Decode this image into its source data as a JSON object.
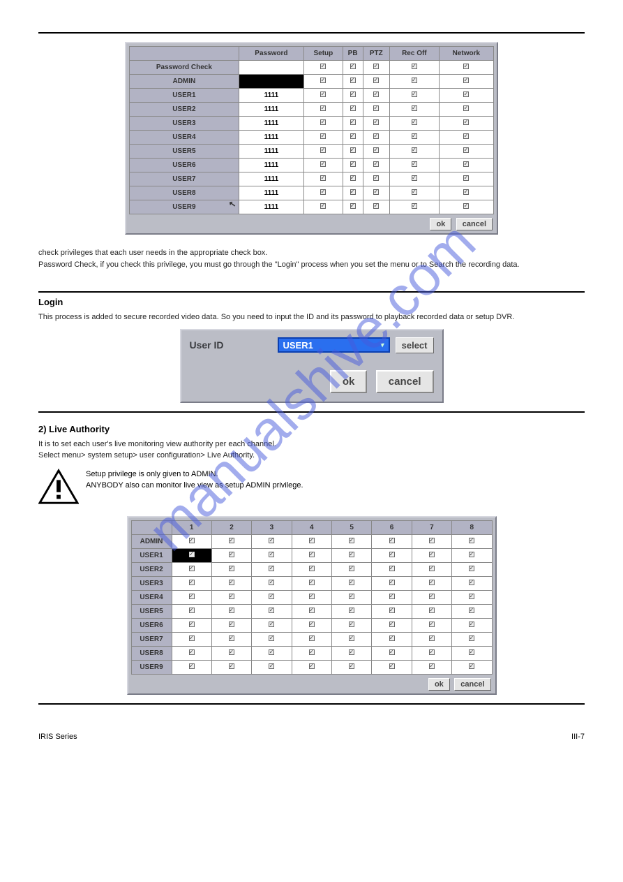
{
  "watermark_text": "manualshive.com",
  "section1": {
    "desc1": "check privileges that each user needs in the appropriate check box.",
    "desc2": "Password Check, if you check this privilege, you must go through the \"Login\" process when you set the menu or to Search the recording data.",
    "table": {
      "headers": [
        "Password",
        "Setup",
        "PB",
        "PTZ",
        "Rec Off",
        "Network"
      ],
      "row0_label": "Password Check",
      "rows": [
        {
          "label": "ADMIN",
          "pwd": ""
        },
        {
          "label": "USER1",
          "pwd": "1111"
        },
        {
          "label": "USER2",
          "pwd": "1111"
        },
        {
          "label": "USER3",
          "pwd": "1111"
        },
        {
          "label": "USER4",
          "pwd": "1111"
        },
        {
          "label": "USER5",
          "pwd": "1111"
        },
        {
          "label": "USER6",
          "pwd": "1111"
        },
        {
          "label": "USER7",
          "pwd": "1111"
        },
        {
          "label": "USER8",
          "pwd": "1111"
        },
        {
          "label": "USER9",
          "pwd": "1111"
        }
      ]
    },
    "btn_ok": "ok",
    "btn_cancel": "cancel"
  },
  "section2": {
    "heading": "Login",
    "desc": "This process is added to secure recorded video data. So you need to input the ID and its password to playback recorded data or setup DVR.",
    "label": "User  ID",
    "field_value": "USER1",
    "btn_select": "select",
    "btn_ok": "ok",
    "btn_cancel": "cancel"
  },
  "section3": {
    "heading": "2) Live Authority",
    "desc1": "It is to set each user's live monitoring view authority per each channel.",
    "desc2": "Select menu> system setup> user configuration> Live Authority.",
    "caution": "Setup privilege is only given to ADMIN.\nANYBODY also can monitor live view as setup ADMIN privilege.",
    "table": {
      "headers": [
        "1",
        "2",
        "3",
        "4",
        "5",
        "6",
        "7",
        "8"
      ],
      "rows": [
        {
          "label": "ADMIN"
        },
        {
          "label": "USER1"
        },
        {
          "label": "USER2"
        },
        {
          "label": "USER3"
        },
        {
          "label": "USER4"
        },
        {
          "label": "USER5"
        },
        {
          "label": "USER6"
        },
        {
          "label": "USER7"
        },
        {
          "label": "USER8"
        },
        {
          "label": "USER9"
        }
      ]
    },
    "btn_ok": "ok",
    "btn_cancel": "cancel"
  },
  "footer": {
    "left": "IRIS Series",
    "right": "III-7"
  }
}
